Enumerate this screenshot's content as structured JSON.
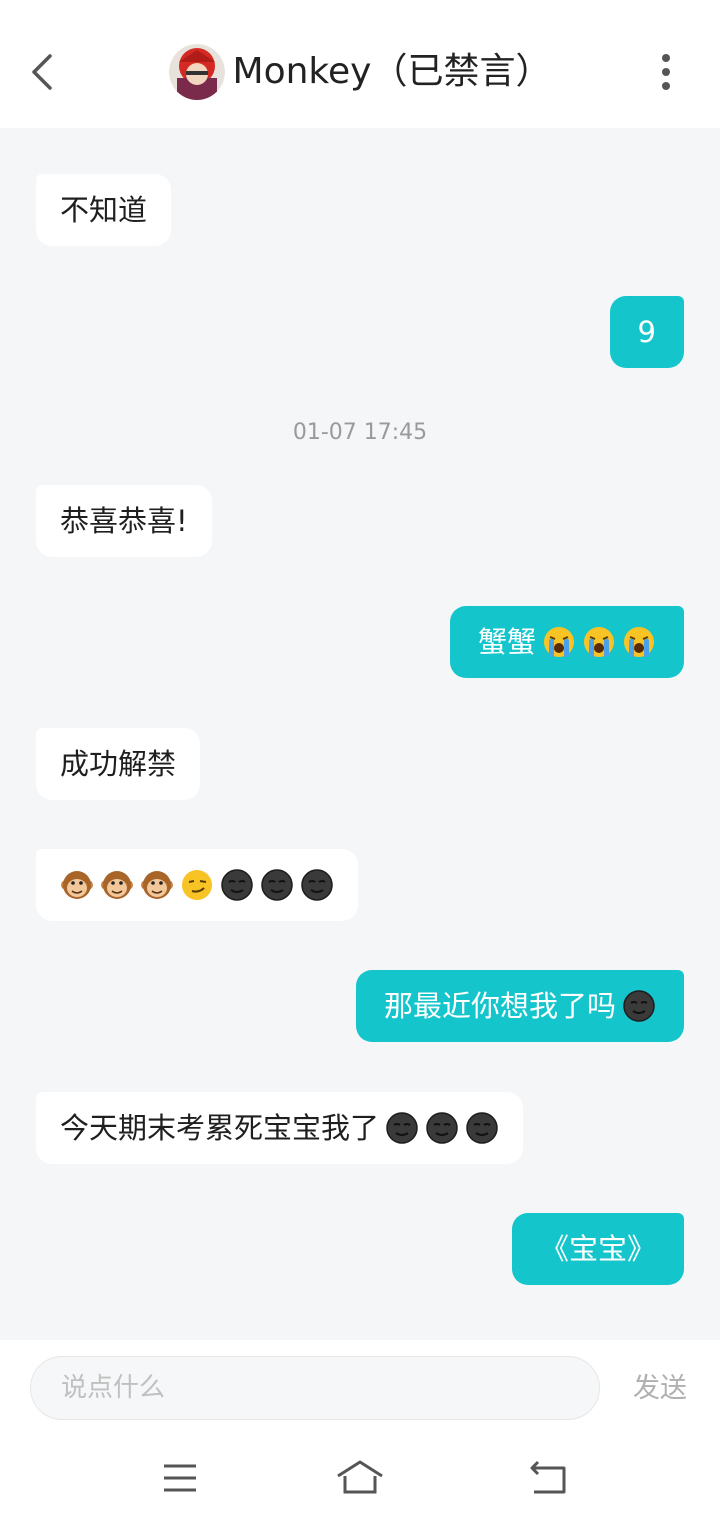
{
  "header": {
    "title": "Monkey（已禁言）"
  },
  "messages": [
    {
      "side": "left",
      "text": "不知道",
      "emojis": []
    },
    {
      "side": "right",
      "text": "9",
      "emojis": []
    },
    {
      "side": "left",
      "text": "恭喜恭喜!",
      "emojis": []
    },
    {
      "side": "right",
      "text": "蟹蟹",
      "emojis": [
        "loudly-crying-face",
        "loudly-crying-face",
        "loudly-crying-face"
      ]
    },
    {
      "side": "left",
      "text": "成功解禁",
      "emojis": []
    },
    {
      "side": "left",
      "text": "",
      "emojis": [
        "monkey-face",
        "monkey-face",
        "monkey-face",
        "smirking-face",
        "new-moon-face",
        "new-moon-face",
        "new-moon-face"
      ]
    },
    {
      "side": "right",
      "text": "那最近你想我了吗",
      "emojis": [
        "new-moon-face"
      ]
    },
    {
      "side": "left",
      "text": "今天期末考累死宝宝我了",
      "emojis": [
        "new-moon-face",
        "new-moon-face",
        "new-moon-face"
      ]
    },
    {
      "side": "right",
      "text": "《宝宝》",
      "emojis": []
    }
  ],
  "timestamp": "01-07 17:45",
  "composer": {
    "placeholder": "说点什么",
    "send_label": "发送"
  },
  "colors": {
    "accent": "#14c6cc",
    "background": "#f4f6f8"
  }
}
